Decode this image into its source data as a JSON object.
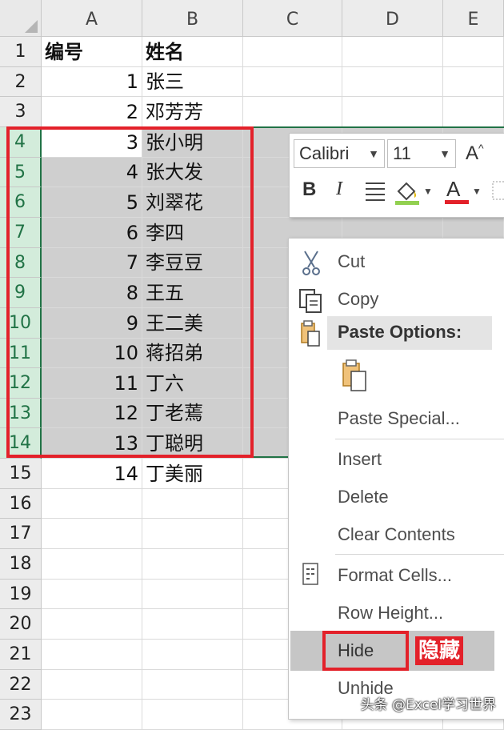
{
  "sheet": {
    "columns": [
      "A",
      "B",
      "C",
      "D",
      "E"
    ],
    "selected_columns": [],
    "rows": [
      {
        "num": "1",
        "a": "编号",
        "b": "姓名"
      },
      {
        "num": "2",
        "a": "1",
        "b": "张三"
      },
      {
        "num": "3",
        "a": "2",
        "b": "邓芳芳"
      },
      {
        "num": "4",
        "a": "3",
        "b": "张小明"
      },
      {
        "num": "5",
        "a": "4",
        "b": "张大发"
      },
      {
        "num": "6",
        "a": "5",
        "b": "刘翠花"
      },
      {
        "num": "7",
        "a": "6",
        "b": "李四"
      },
      {
        "num": "8",
        "a": "7",
        "b": "李豆豆"
      },
      {
        "num": "9",
        "a": "8",
        "b": "王五"
      },
      {
        "num": "10",
        "a": "9",
        "b": "王二美"
      },
      {
        "num": "11",
        "a": "10",
        "b": "蒋招弟"
      },
      {
        "num": "12",
        "a": "11",
        "b": "丁六"
      },
      {
        "num": "13",
        "a": "12",
        "b": "丁老蔫"
      },
      {
        "num": "14",
        "a": "13",
        "b": "丁聪明"
      },
      {
        "num": "15",
        "a": "14",
        "b": "丁美丽"
      },
      {
        "num": "16",
        "a": "",
        "b": ""
      },
      {
        "num": "17",
        "a": "",
        "b": ""
      },
      {
        "num": "18",
        "a": "",
        "b": ""
      },
      {
        "num": "19",
        "a": "",
        "b": ""
      },
      {
        "num": "20",
        "a": "",
        "b": ""
      },
      {
        "num": "21",
        "a": "",
        "b": ""
      },
      {
        "num": "22",
        "a": "",
        "b": ""
      },
      {
        "num": "23",
        "a": "",
        "b": ""
      }
    ],
    "selected_rows": [
      "4",
      "5",
      "6",
      "7",
      "8",
      "9",
      "10",
      "11",
      "12",
      "13",
      "14"
    ]
  },
  "mini_toolbar": {
    "font_name": "Calibri",
    "font_size": "11",
    "grow_font": "A",
    "bold": "B",
    "italic": "I",
    "font_color": "A"
  },
  "context_menu": {
    "cut": "Cut",
    "copy": "Copy",
    "paste_options": "Paste Options:",
    "paste_special": "Paste Special...",
    "insert": "Insert",
    "delete": "Delete",
    "clear_contents": "Clear Contents",
    "format_cells": "Format Cells...",
    "row_height": "Row Height...",
    "hide": "Hide",
    "unhide": "Unhide"
  },
  "annotation": {
    "hide_label": "隐藏"
  },
  "watermark": "头条 @Excel学习世界",
  "colors": {
    "excel_green": "#217346",
    "annotation_red": "#e3212a",
    "selection_gray": "#cfcfcf"
  }
}
